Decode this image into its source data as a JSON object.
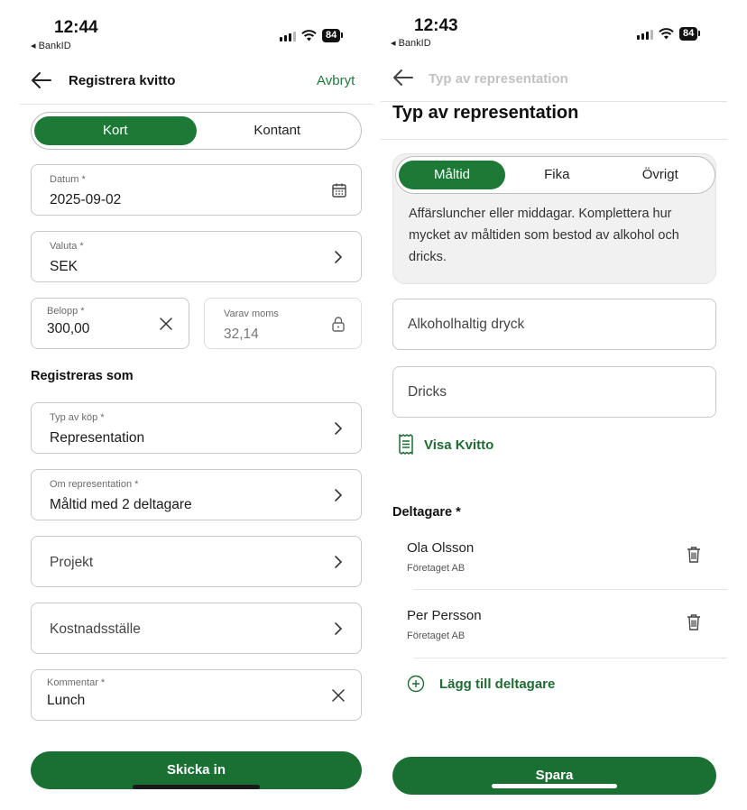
{
  "left": {
    "status": {
      "time": "12:44",
      "back_app": "◂ BankID",
      "battery": "84"
    },
    "header": {
      "title": "Registrera kvitto",
      "cancel": "Avbryt"
    },
    "payment_tabs": [
      "Kort",
      "Kontant"
    ],
    "fields": {
      "datum": {
        "label": "Datum *",
        "value": "2025-09-02"
      },
      "valuta": {
        "label": "Valuta *",
        "value": "SEK"
      },
      "belopp": {
        "label": "Belopp *",
        "value": "300,00"
      },
      "moms": {
        "label": "Varav moms",
        "value": "32,14"
      }
    },
    "section_title": "Registreras som",
    "typ_av_kop": {
      "label": "Typ av köp *",
      "value": "Representation"
    },
    "om_representation": {
      "label": "Om representation *",
      "value": "Måltid med 2 deltagare"
    },
    "projekt": {
      "value": "Projekt"
    },
    "kostnadsstalle": {
      "value": "Kostnadsställe"
    },
    "kommentar": {
      "label": "Kommentar *",
      "value": "Lunch"
    },
    "submit": "Skicka in"
  },
  "right": {
    "status": {
      "time": "12:43",
      "back_app": "◂ BankID",
      "battery": "84"
    },
    "header": {
      "title": "Typ av representation"
    },
    "heading": "Typ av representation",
    "type_tabs": [
      "Måltid",
      "Fika",
      "Övrigt"
    ],
    "description": "Affärsluncher eller middagar. Komplettera hur mycket av måltiden som bestod av alkohol och dricks.",
    "alkohol_placeholder": "Alkoholhaltig dryck",
    "dricks_placeholder": "Dricks",
    "visa_kvitto": "Visa Kvitto",
    "participants_title": "Deltagare *",
    "participants": [
      {
        "name": "Ola Olsson",
        "company": "Företaget AB"
      },
      {
        "name": "Per Persson",
        "company": "Företaget AB"
      }
    ],
    "add_participant": "Lägg till deltagare",
    "save": "Spara"
  },
  "colors": {
    "accent": "#1c7a36",
    "link": "#1f7a3a"
  }
}
